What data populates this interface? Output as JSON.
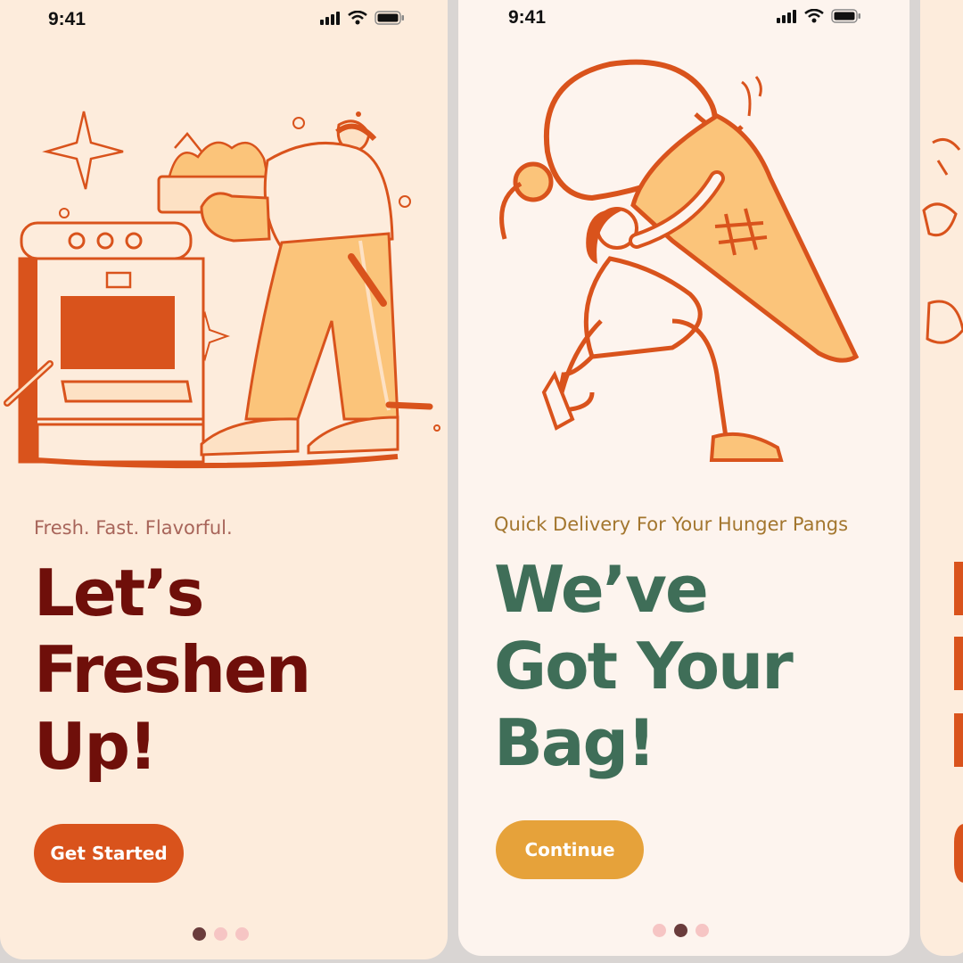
{
  "screens": [
    {
      "status_time": "9:41",
      "tagline": "Fresh. Fast. Flavorful.",
      "headline_lines": [
        "Let’s",
        "Freshen",
        "Up!"
      ],
      "cta_label": "Get Started",
      "active_dot": 1,
      "colors": {
        "headline": "#6f0f0a",
        "cta": "#d9531c",
        "background": "#fdecdc"
      }
    },
    {
      "status_time": "9:41",
      "tagline": "Quick Delivery For Your Hunger Pangs",
      "headline_lines": [
        "We’ve",
        "Got Your",
        "Bag!"
      ],
      "cta_label": "Continue",
      "active_dot": 2,
      "colors": {
        "headline": "#3f6e58",
        "cta": "#e6a23a",
        "background": "#fdf4ee"
      }
    }
  ],
  "icons": [
    "signal-icon",
    "wifi-icon",
    "battery-icon",
    "chef-oven-illustration",
    "ice-cream-carrier-illustration"
  ]
}
